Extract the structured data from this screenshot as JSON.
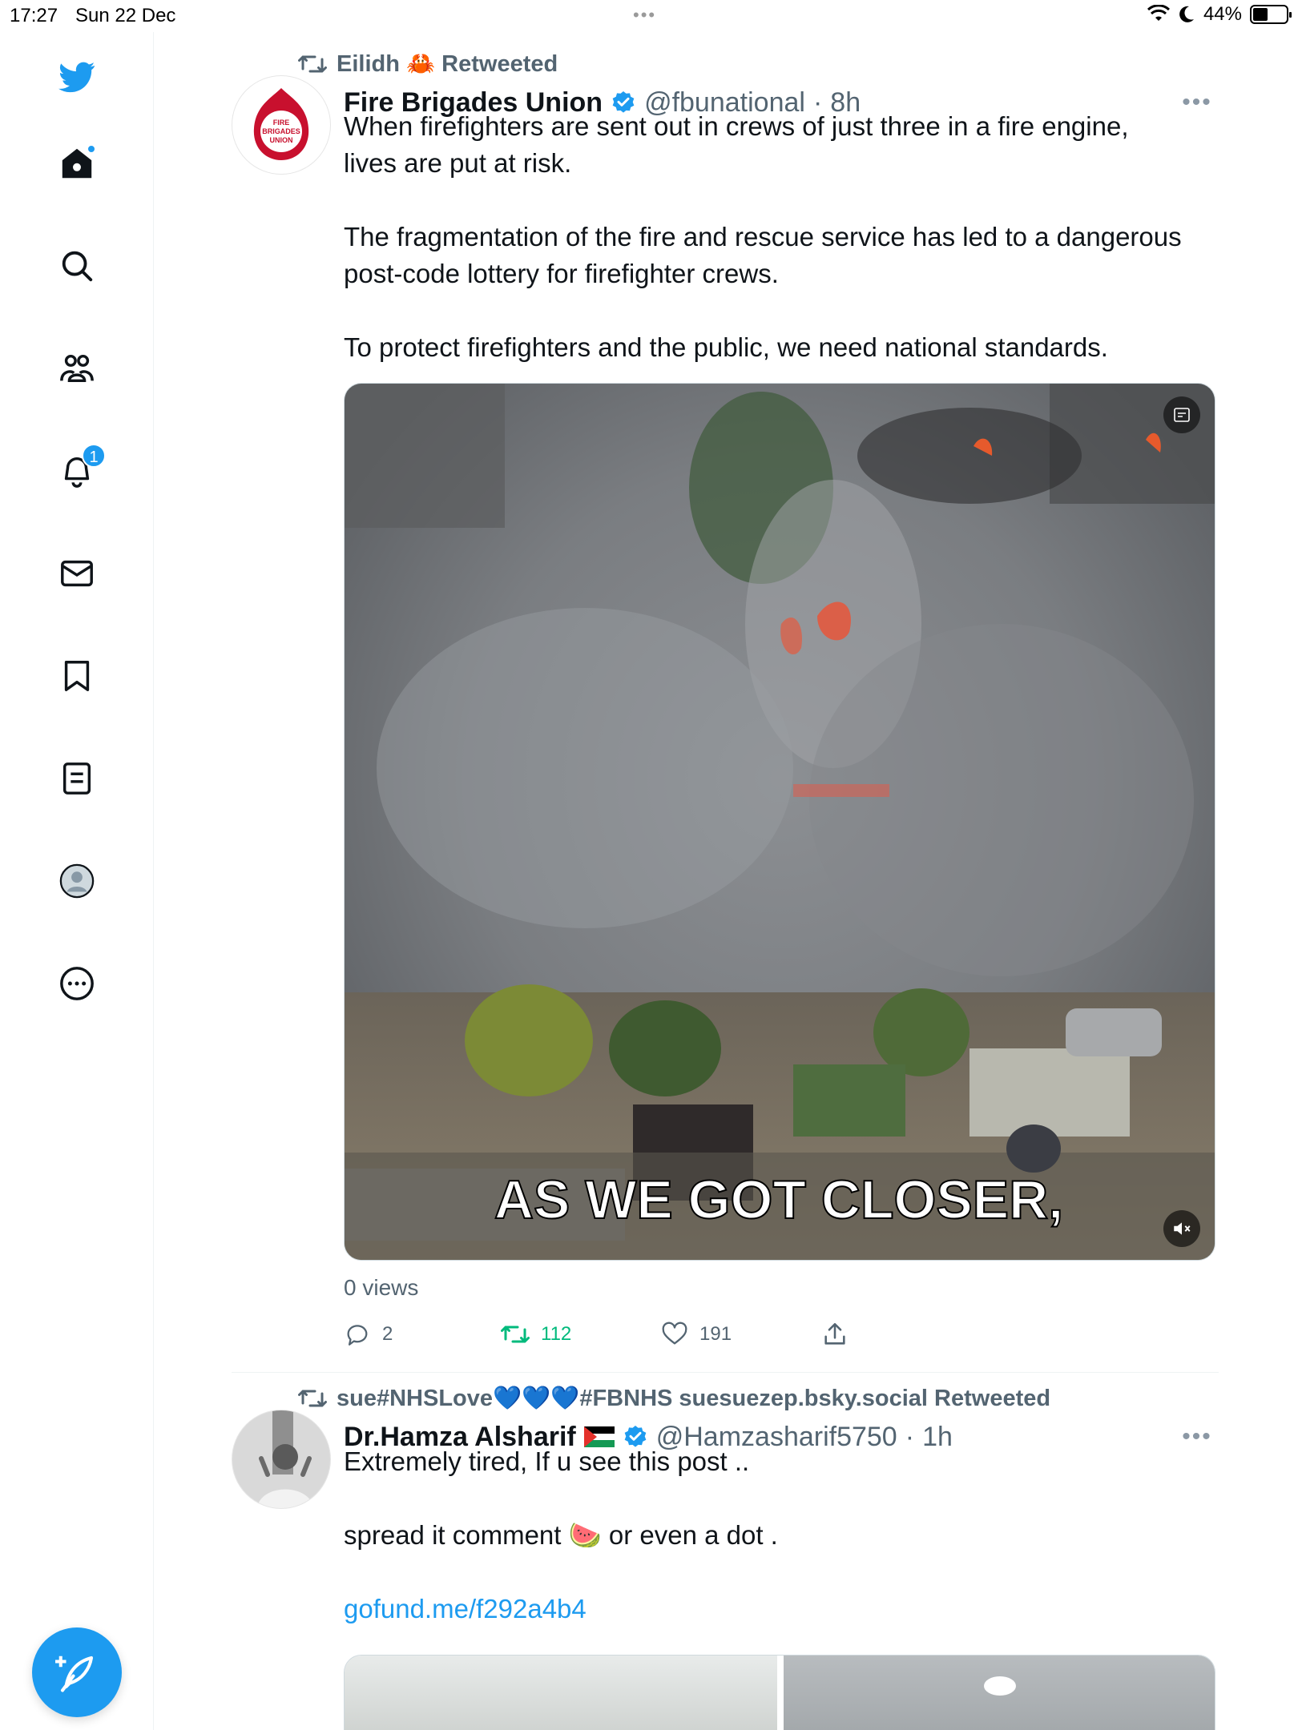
{
  "status_bar": {
    "time": "17:27",
    "date": "Sun 22 Dec",
    "battery": "44%"
  },
  "sidebar": {
    "items": [
      {
        "name": "twitter-logo"
      },
      {
        "name": "home",
        "has_dot": true
      },
      {
        "name": "search"
      },
      {
        "name": "communities"
      },
      {
        "name": "notifications",
        "badge": "1"
      },
      {
        "name": "messages"
      },
      {
        "name": "bookmarks"
      },
      {
        "name": "lists"
      },
      {
        "name": "profile"
      },
      {
        "name": "more"
      }
    ],
    "compose_label": "Post"
  },
  "tweets": [
    {
      "social_context": "Eilidh 🦀 Retweeted",
      "display_name": "Fire Brigades Union",
      "handle": "@fbunational",
      "separator": "·",
      "age": "8h",
      "avatar_text": "FIRE BRIGADES UNION",
      "text_lines": [
        "When firefighters are sent out in crews of just three in a fire engine,",
        "lives are put at risk.",
        "",
        "The fragmentation of the fire and rescue service has led to a dangerous",
        "post-code lottery for firefighter crews.",
        "",
        "To protect firefighters and the public, we need national standards."
      ],
      "video_caption": "AS WE GOT CLOSER,",
      "views": "0 views",
      "replies": "2",
      "retweets": "112",
      "likes": "191"
    },
    {
      "social_context": "sue#NHSLove💙💙💙#FBNHS suesuezep.bsky.social Retweeted",
      "display_name": "Dr.Hamza Alsharif",
      "handle": "@Hamzasharif5750",
      "separator": "·",
      "age": "1h",
      "text_lines": [
        "Extremely tired, If u see this post ..",
        "",
        "spread it comment 🍉 or even a dot ."
      ],
      "link": "gofund.me/f292a4b4"
    }
  ],
  "colors": {
    "accent": "#1d9bf0",
    "retweet_green": "#00ba7c",
    "secondary_text": "#536471"
  }
}
